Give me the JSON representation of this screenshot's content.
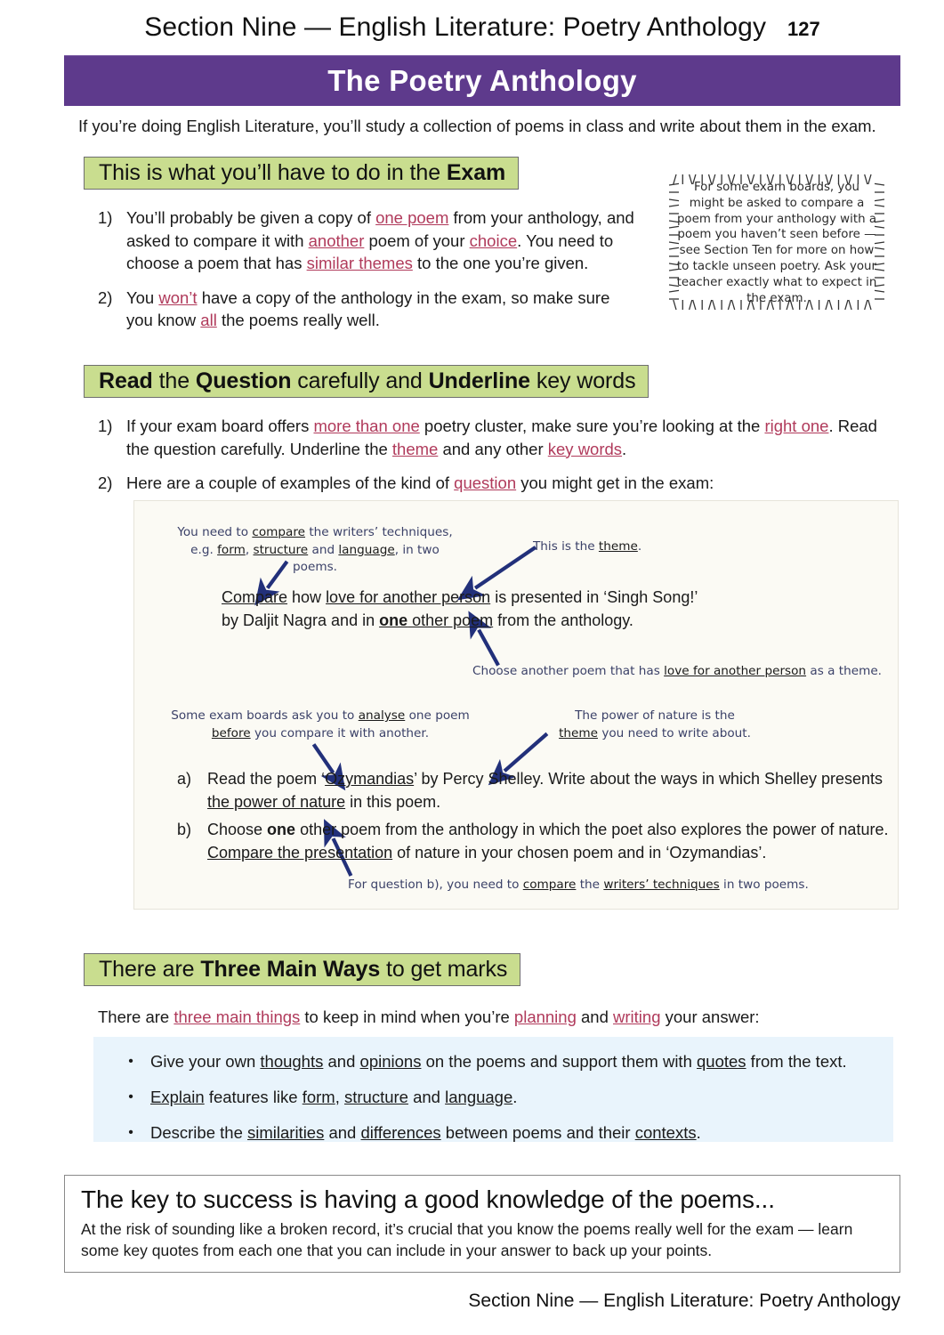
{
  "running_head": {
    "title": "Section Nine — English Literature: Poetry Anthology",
    "page_number": "127"
  },
  "banner": {
    "title": "The Poetry Anthology",
    "color": "#5e3a8c"
  },
  "intro": "If you’re doing English Literature, you’ll study a collection of poems in class and write about them in the exam.",
  "section_1": {
    "heading_plain_1": "This is what you’ll have to do in the ",
    "heading_bold_1": "Exam",
    "items": [
      {
        "num": "1)",
        "parts": [
          {
            "t": "You’ll probably be given a copy of ",
            "s": "plain"
          },
          {
            "t": "one poem",
            "s": "key"
          },
          {
            "t": " from your anthology, and asked to compare it with ",
            "s": "plain"
          },
          {
            "t": "another",
            "s": "key"
          },
          {
            "t": " poem of your ",
            "s": "plain"
          },
          {
            "t": "choice",
            "s": "key"
          },
          {
            "t": ".  You need to choose a poem that has ",
            "s": "plain"
          },
          {
            "t": "similar themes",
            "s": "key"
          },
          {
            "t": " to the one you’re given.",
            "s": "plain"
          }
        ]
      },
      {
        "num": "2)",
        "parts": [
          {
            "t": "You ",
            "s": "plain"
          },
          {
            "t": "won’t",
            "s": "key"
          },
          {
            "t": " have a copy of the anthology in the exam, so make sure you know ",
            "s": "plain"
          },
          {
            "t": "all",
            "s": "key"
          },
          {
            "t": " the poems really well.",
            "s": "plain"
          }
        ]
      }
    ]
  },
  "note": {
    "text": "For some exam boards, you might be asked to compare a poem from your anthology with a poem you haven’t seen before — see Section Ten for more on how to tackle unseen poetry.  Ask your teacher exactly what to expect in the exam."
  },
  "section_2": {
    "heading_parts": [
      {
        "t": "Read",
        "s": "bold"
      },
      {
        "t": " the ",
        "s": "plain"
      },
      {
        "t": "Question",
        "s": "bold"
      },
      {
        "t": " carefully and ",
        "s": "plain"
      },
      {
        "t": "Underline",
        "s": "bold"
      },
      {
        "t": " key words",
        "s": "plain"
      }
    ],
    "items": [
      {
        "num": "1)",
        "parts": [
          {
            "t": "If your exam board offers ",
            "s": "plain"
          },
          {
            "t": "more than one",
            "s": "key"
          },
          {
            "t": " poetry cluster, make sure you’re looking at the ",
            "s": "plain"
          },
          {
            "t": "right one",
            "s": "key"
          },
          {
            "t": ". Read the question carefully.  Underline the ",
            "s": "plain"
          },
          {
            "t": "theme",
            "s": "key"
          },
          {
            "t": " and any other ",
            "s": "plain"
          },
          {
            "t": "key words",
            "s": "key"
          },
          {
            "t": ".",
            "s": "plain"
          }
        ]
      },
      {
        "num": "2)",
        "parts": [
          {
            "t": "Here are a couple of examples of the kind of ",
            "s": "plain"
          },
          {
            "t": "question",
            "s": "key"
          },
          {
            "t": " you might get in the exam:",
            "s": "plain"
          }
        ]
      }
    ]
  },
  "example_box": {
    "annotations": [
      {
        "id": "anno-1",
        "parts": [
          {
            "t": "You need to ",
            "s": "plain"
          },
          {
            "t": "compare",
            "s": "ul"
          },
          {
            "t": " the writers’ techniques,\ne.g. ",
            "s": "plain"
          },
          {
            "t": "form",
            "s": "ul"
          },
          {
            "t": ", ",
            "s": "plain"
          },
          {
            "t": "structure",
            "s": "ul"
          },
          {
            "t": " and ",
            "s": "plain"
          },
          {
            "t": "language",
            "s": "ul"
          },
          {
            "t": ", in two poems.",
            "s": "plain"
          }
        ]
      },
      {
        "id": "anno-2",
        "parts": [
          {
            "t": "This is the ",
            "s": "plain"
          },
          {
            "t": "theme",
            "s": "ul"
          },
          {
            "t": ".",
            "s": "plain"
          }
        ]
      },
      {
        "id": "anno-3",
        "parts": [
          {
            "t": "Choose another poem that has ",
            "s": "plain"
          },
          {
            "t": "love for another person",
            "s": "ul"
          },
          {
            "t": " as a theme.",
            "s": "plain"
          }
        ]
      },
      {
        "id": "anno-4",
        "parts": [
          {
            "t": "Some exam boards ask you to ",
            "s": "plain"
          },
          {
            "t": "analyse",
            "s": "ul"
          },
          {
            "t": " one poem\n",
            "s": "plain"
          },
          {
            "t": "before",
            "s": "ul"
          },
          {
            "t": " you compare it with another.",
            "s": "plain"
          }
        ]
      },
      {
        "id": "anno-5",
        "parts": [
          {
            "t": "The power of nature is the\n",
            "s": "plain"
          },
          {
            "t": "theme",
            "s": "ul"
          },
          {
            "t": " you need to write about.",
            "s": "plain"
          }
        ]
      },
      {
        "id": "anno-6",
        "parts": [
          {
            "t": "For question b), you need to ",
            "s": "plain"
          },
          {
            "t": "compare",
            "s": "ul"
          },
          {
            "t": " the ",
            "s": "plain"
          },
          {
            "t": "writers’ techniques",
            "s": "ul"
          },
          {
            "t": " in two poems.",
            "s": "plain"
          }
        ]
      }
    ],
    "question_1": [
      {
        "t": "Compare",
        "s": "ul"
      },
      {
        "t": " how ",
        "s": "plain"
      },
      {
        "t": "love for another person",
        "s": "ul"
      },
      {
        "t": " is presented in ‘Singh Song!’\nby Daljit Nagra and in ",
        "s": "plain"
      },
      {
        "t": "one",
        "s": "bold-ul"
      },
      {
        "t": " other poem",
        "s": "ul"
      },
      {
        "t": " from the anthology.",
        "s": "plain"
      }
    ],
    "question_2": [
      {
        "num": "a)",
        "parts": [
          {
            "t": "Read the poem ‘",
            "s": "plain"
          },
          {
            "t": "Ozymandias",
            "s": "ul"
          },
          {
            "t": "’ by Percy Shelley.  Write about the ways in which Shelley presents ",
            "s": "plain"
          },
          {
            "t": "the power of nature",
            "s": "ul"
          },
          {
            "t": " in this poem.",
            "s": "plain"
          }
        ]
      },
      {
        "num": "b)",
        "parts": [
          {
            "t": "Choose ",
            "s": "plain"
          },
          {
            "t": "one",
            "s": "bold"
          },
          {
            "t": " other poem from the anthology in which the poet also explores the power of nature.  ",
            "s": "plain"
          },
          {
            "t": "Compare the presentation",
            "s": "ul"
          },
          {
            "t": " of nature in your chosen poem and in ‘Ozymandias’.",
            "s": "plain"
          }
        ]
      }
    ],
    "arrow_color": "#22307a"
  },
  "section_3": {
    "heading_parts": [
      {
        "t": "There are ",
        "s": "plain"
      },
      {
        "t": "Three Main Ways",
        "s": "bold"
      },
      {
        "t": " to get marks",
        "s": "plain"
      }
    ],
    "intro_parts": [
      {
        "t": "There are ",
        "s": "plain"
      },
      {
        "t": "three main things",
        "s": "key"
      },
      {
        "t": " to keep in mind when you’re ",
        "s": "plain"
      },
      {
        "t": "planning",
        "s": "key"
      },
      {
        "t": " and ",
        "s": "plain"
      },
      {
        "t": "writing",
        "s": "key"
      },
      {
        "t": " your answer:",
        "s": "plain"
      }
    ],
    "bullet_char": "•",
    "bullets": [
      [
        {
          "t": "Give your own ",
          "s": "plain"
        },
        {
          "t": "thoughts",
          "s": "ul"
        },
        {
          "t": " and ",
          "s": "plain"
        },
        {
          "t": "opinions",
          "s": "ul"
        },
        {
          "t": " on the poems and support them with ",
          "s": "plain"
        },
        {
          "t": "quotes",
          "s": "ul"
        },
        {
          "t": " from the text.",
          "s": "plain"
        }
      ],
      [
        {
          "t": "Explain",
          "s": "ul"
        },
        {
          "t": " features like ",
          "s": "plain"
        },
        {
          "t": "form",
          "s": "ul"
        },
        {
          "t": ", ",
          "s": "plain"
        },
        {
          "t": "structure",
          "s": "ul"
        },
        {
          "t": " and ",
          "s": "plain"
        },
        {
          "t": "language",
          "s": "ul"
        },
        {
          "t": ".",
          "s": "plain"
        }
      ],
      [
        {
          "t": "Describe the ",
          "s": "plain"
        },
        {
          "t": "similarities",
          "s": "ul"
        },
        {
          "t": " and ",
          "s": "plain"
        },
        {
          "t": "differences",
          "s": "ul"
        },
        {
          "t": " between poems and their ",
          "s": "plain"
        },
        {
          "t": "contexts",
          "s": "ul"
        },
        {
          "t": ".",
          "s": "plain"
        }
      ]
    ]
  },
  "key_box": {
    "title": "The key to success is having a good knowledge of the poems...",
    "body": "At the risk of sounding like a broken record, it’s crucial that you know the poems really well for the exam — learn some key quotes from each one that you can include in your answer to back up your points."
  },
  "footer": "Section Nine — English Literature: Poetry Anthology",
  "colors": {
    "banner_purple": "#5e3a8c",
    "header_green": "#c9dd8f",
    "bullet_box_blue": "#e9f4fc",
    "example_box_cream": "#fbfaf4",
    "key_underline_red": "#b03a5b",
    "annotation_blue": "#3b4168"
  }
}
